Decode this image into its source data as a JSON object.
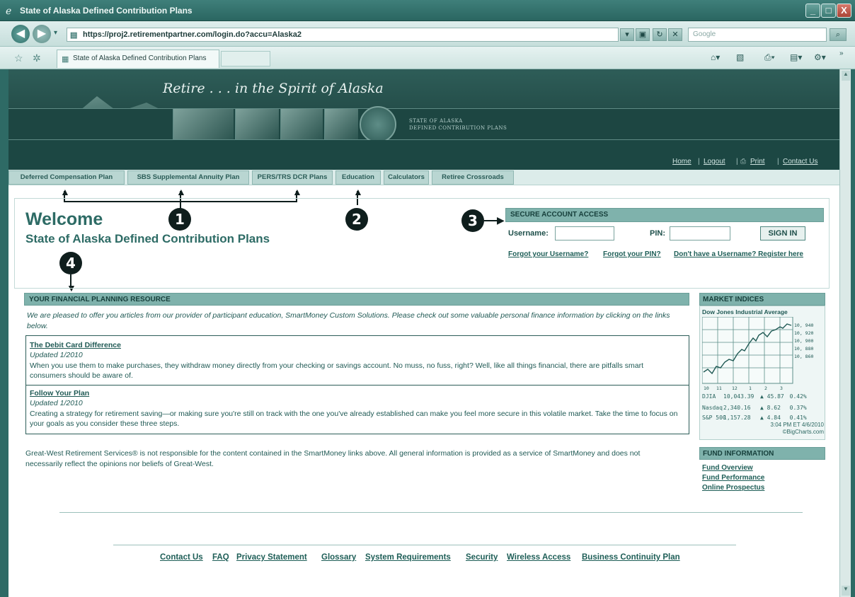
{
  "window": {
    "title": "State of Alaska Defined Contribution Plans",
    "buttons": {
      "minimize": "_",
      "maximize": "□",
      "close": "X"
    }
  },
  "browser": {
    "url": "https://proj2.retirementpartner.com/login.do?accu=Alaska2",
    "search_placeholder": "Google",
    "tab_title": "State of Alaska Defined Contribution Plans"
  },
  "banner": {
    "slogan": "Retire . . . in the Spirit of Alaska",
    "org_line1": "STATE OF ALASKA",
    "org_line2": "DEFINED CONTRIBUTION PLANS"
  },
  "utility_nav": {
    "home": "Home",
    "logout": "Logout",
    "print": "Print",
    "contact": "Contact Us"
  },
  "main_nav": [
    "Deferred Compensation Plan",
    "SBS Supplemental Annuity Plan",
    "PERS/TRS DCR Plans",
    "Education",
    "Calculators",
    "Retiree Crossroads"
  ],
  "callouts": [
    "1",
    "2",
    "3",
    "4"
  ],
  "welcome": {
    "heading": "Welcome",
    "subheading": "State of Alaska Defined Contribution Plans"
  },
  "login": {
    "title": "SECURE ACCOUNT ACCESS",
    "username_label": "Username:",
    "pin_label": "PIN:",
    "submit": "SIGN IN",
    "forgot_username": "Forgot your Username?",
    "forgot_pin": "Forgot your PIN?",
    "register": "Don't have a Username? Register here"
  },
  "resource": {
    "title": "YOUR FINANCIAL PLANNING RESOURCE",
    "intro": "We are pleased to offer you articles from our provider of participant education, SmartMoney Custom Solutions. Please check out some valuable personal finance information by clicking on the links below.",
    "articles": [
      {
        "title": "The Debit Card Difference",
        "updated": "Updated 1/2010",
        "body": "When you use them to make purchases, they withdraw money directly from your checking or savings account. No muss, no fuss, right? Well, like all things financial, there are pitfalls smart consumers should be aware of."
      },
      {
        "title": "Follow Your Plan",
        "updated": "Updated 1/2010",
        "body": "Creating a strategy for retirement saving—or making sure you're still on track with the one you've already established can make you feel more secure in this volatile market. Take the time to focus on your goals as you consider these three steps."
      }
    ],
    "disclaimer": "Great-West Retirement Services® is not responsible for the content contained in the SmartMoney links above. All general information is provided as a service of SmartMoney and does not necessarily reflect the opinions nor beliefs of Great-West."
  },
  "market": {
    "title": "MARKET INDICES",
    "chart_title": "Dow Jones Industrial Average",
    "y_ticks": [
      "10, 940",
      "10, 920",
      "10, 900",
      "10, 880",
      "10, 860"
    ],
    "x_ticks": [
      "10",
      "11",
      "12",
      "1",
      "2",
      "3"
    ],
    "indices": [
      {
        "name": "DJIA",
        "value": "10,043.39",
        "change": "45.87",
        "pct": "0.42%"
      },
      {
        "name": "Nasdaq",
        "value": "2,340.16",
        "change": "8.62",
        "pct": "0.37%"
      },
      {
        "name": "S&P 500",
        "value": "1,157.28",
        "change": "4.84",
        "pct": "0.41%"
      }
    ],
    "timestamp": "3:04 PM ET 4/6/2010",
    "credit": "©BigCharts.com"
  },
  "fund": {
    "title": "FUND INFORMATION",
    "links": [
      "Fund Overview",
      "Fund Performance",
      "Online Prospectus"
    ]
  },
  "footer": [
    "Contact Us",
    "FAQ",
    "Privacy Statement",
    "Glossary",
    "System Requirements",
    "Security",
    "Wireless Access",
    "Business Continuity Plan"
  ],
  "colors": {
    "accent": "#2d6b65",
    "header_bar": "#7fb2ac",
    "link": "#1e5e57"
  }
}
